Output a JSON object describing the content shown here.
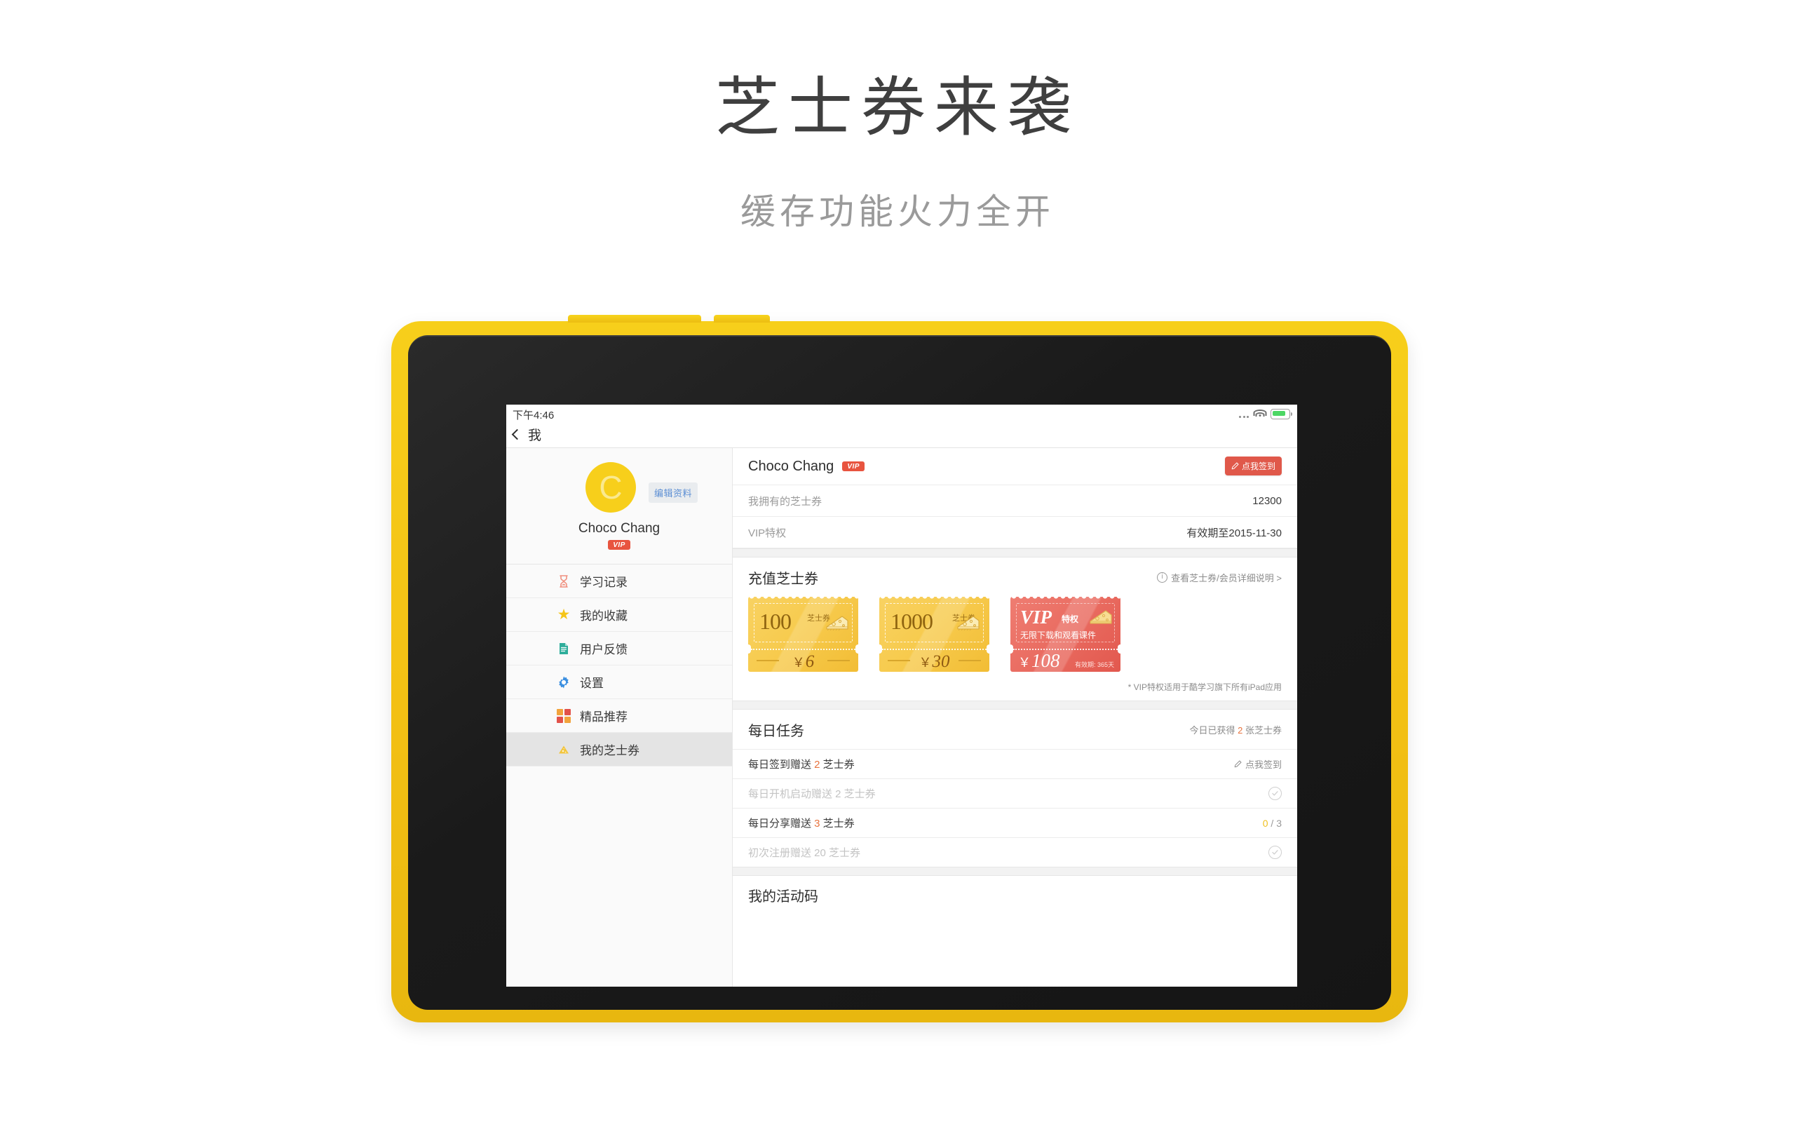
{
  "promo": {
    "title": "芝士券来袭",
    "subtitle": "缓存功能火力全开"
  },
  "statusbar": {
    "time": "下午4:46"
  },
  "navbar": {
    "title": "我"
  },
  "sidebar": {
    "profile": {
      "avatar_letter": "C",
      "edit_label": "编辑资料",
      "name": "Choco Chang",
      "vip_label": "VIP"
    },
    "items": [
      {
        "label": "学习记录",
        "icon": "hourglass-icon"
      },
      {
        "label": "我的收藏",
        "icon": "star-icon"
      },
      {
        "label": "用户反馈",
        "icon": "document-icon"
      },
      {
        "label": "设置",
        "icon": "gear-icon"
      },
      {
        "label": "精品推荐",
        "icon": "grid-icon"
      },
      {
        "label": "我的芝士券",
        "icon": "cheese-icon"
      }
    ]
  },
  "account": {
    "name": "Choco Chang",
    "vip_label": "VIP",
    "signin_label": "点我签到",
    "rows": [
      {
        "key": "我拥有的芝士券",
        "value": "12300"
      },
      {
        "key": "VIP特权",
        "value": "有效期至2015-11-30"
      }
    ]
  },
  "recharge": {
    "title": "充值芝士券",
    "detail_link": "查看芝士券/会员详细说明 >",
    "note": "* VIP特权适用于酷学习旗下所有iPad应用",
    "coupons": [
      {
        "amount": "100",
        "unit": "芝士券",
        "currency": "￥",
        "price": "6"
      },
      {
        "amount": "1000",
        "unit": "芝士券",
        "currency": "￥",
        "price": "30"
      }
    ],
    "vip_coupon": {
      "title": "VIP",
      "subtitle": "特权",
      "desc": "无限下载和观看课件",
      "currency": "￥",
      "price": "108",
      "valid": "有效期: 365天"
    }
  },
  "daily": {
    "title": "每日任务",
    "earned_prefix": "今日已获得 ",
    "earned_count": "2",
    "earned_suffix": " 张芝士券",
    "tasks": [
      {
        "prefix": "每日签到赠送 ",
        "count": "2",
        "suffix": " 芝士券",
        "action": "点我签到",
        "state": "action",
        "dim": false
      },
      {
        "prefix": "每日开机启动赠送 ",
        "count": "2",
        "suffix": " 芝士券",
        "action": "",
        "state": "done",
        "dim": true
      },
      {
        "prefix": "每日分享赠送 ",
        "count": "3",
        "suffix": " 芝士券",
        "action": "",
        "state": "progress",
        "progress_current": "0",
        "progress_total": " / 3",
        "dim": false
      },
      {
        "prefix": "初次注册赠送 ",
        "count": "20",
        "suffix": " 芝士券",
        "action": "",
        "state": "done",
        "dim": true
      }
    ]
  },
  "activity": {
    "title": "我的活动码"
  },
  "colors": {
    "brand_yellow": "#f5c518",
    "vip_red": "#e8543f",
    "accent_orange": "#e8743f",
    "link_blue": "#5d8fd4"
  }
}
